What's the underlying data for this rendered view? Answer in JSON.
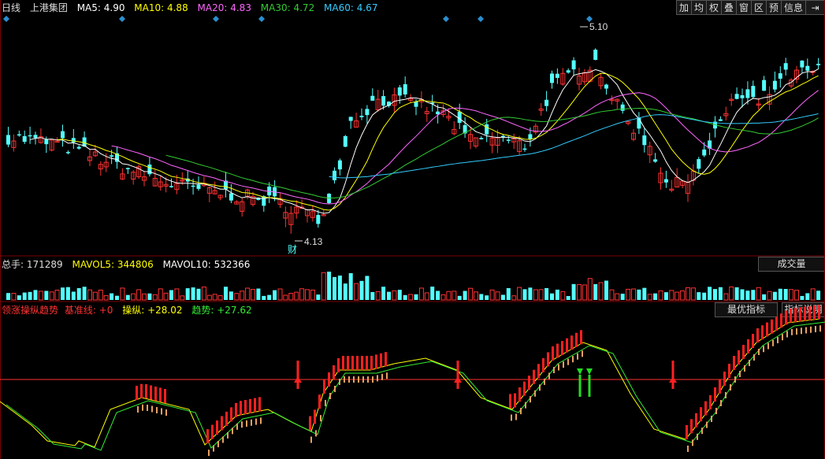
{
  "header": {
    "period": "日线",
    "stock_name": "上港集团",
    "ma": [
      {
        "label": "MA5: 4.90",
        "color": "#ffffff"
      },
      {
        "label": "MA10: 4.88",
        "color": "#ffff00"
      },
      {
        "label": "MA20: 4.83",
        "color": "#ff66ff"
      },
      {
        "label": "MA30: 4.72",
        "color": "#33cc33"
      },
      {
        "label": "MA60: 4.67",
        "color": "#33ccff"
      }
    ]
  },
  "toolbar": [
    "加",
    "均",
    "权",
    "叠",
    "窗",
    "区",
    "预",
    "信息",
    "⇥"
  ],
  "price_chart": {
    "high_label": "5.10",
    "low_label": "4.13",
    "finance_marker": "财",
    "ylim": [
      4.05,
      5.2
    ]
  },
  "volume_panel": {
    "label_total": "总手: 171289",
    "label_mavol5": "MAVOL5: 344806",
    "label_mavol10": "MAVOL10: 532366",
    "dropdown": "成交量"
  },
  "indicator_panel": {
    "title": "领涨操纵趋势",
    "baseline_label": "基准线: +0",
    "manip_label": "操纵: +28.02",
    "trend_label": "趋势: +27.62",
    "btn_best": "最优指标",
    "btn_help": "指标说明"
  },
  "colors": {
    "up": "#ff3232",
    "down": "#54ffff",
    "panel_border": "#7a0000"
  }
}
